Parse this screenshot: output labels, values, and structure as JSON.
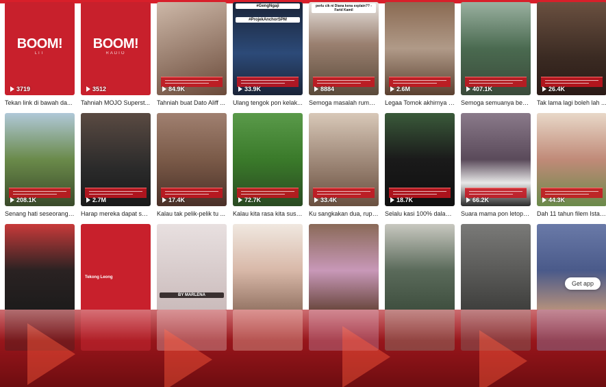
{
  "cards": [
    {
      "views": "3719",
      "caption": "Tekan link di bawah da...",
      "bg": "#c8202c",
      "logo": "BOOM!",
      "logo_sub": "LIT"
    },
    {
      "views": "3512",
      "caption": "Tahniah MOJO Superst...",
      "bg": "#c8202c",
      "logo": "BOOM!",
      "logo_sub": "RADIO"
    },
    {
      "views": "84.9K",
      "caption": "Tahniah buat Dato Aliff ...",
      "bg": "#9a6a58"
    },
    {
      "views": "33.9K",
      "caption": "Ulang tengok pon kelak...",
      "bg": "#2c3d58",
      "top_text": "#GengNgaji",
      "top_text2": "#ProjekAnchorSPM"
    },
    {
      "views": "8884",
      "caption": "Semoga masalah rumah...",
      "bg": "#8c7a6a",
      "top_text": "perlu cik ni Diana kena explain?? - Farid Kamil"
    },
    {
      "views": "2.6M",
      "caption": "Legaa Tomok akhirnya r...",
      "bg": "#6e5a4a"
    },
    {
      "views": "407.1K",
      "caption": "Semoga semuanya berj...",
      "bg": "#5a7a5a"
    },
    {
      "views": "26.4K",
      "caption": "Tak lama lagi boleh lah ...",
      "bg": "#4a3a32"
    },
    {
      "views": "208.1K",
      "caption": "Senang hati seseorang a...",
      "bg": "#6a8a4a"
    },
    {
      "views": "2.7M",
      "caption": "Harap mereka dapat sel...",
      "bg": "#3a3a3a"
    },
    {
      "views": "17.4K",
      "caption": "Kalau tak pelik-pelik tu ...",
      "bg": "#7a5a48"
    },
    {
      "views": "72.7K",
      "caption": "Kalau kita rasa kita susa...",
      "bg": "#4a7a3a"
    },
    {
      "views": "33.4K",
      "caption": "Ku sangkakan dua, rupa...",
      "bg": "#a08a7a"
    },
    {
      "views": "18.7K",
      "caption": "Selalu kasi 100% dalam ...",
      "bg": "#2a2a2a"
    },
    {
      "views": "66.2K",
      "caption": "Suara mama pon letop! ...",
      "bg": "#5a4a5a"
    },
    {
      "views": "44.3K",
      "caption": "Dah 11 tahun filem Istan...",
      "bg": "#8a6a5a"
    },
    {
      "views": "",
      "caption": "",
      "bg": "#3a2a2a"
    },
    {
      "views": "",
      "caption": "",
      "bg": "#c8202c",
      "name_tag": "Tekong Leong"
    },
    {
      "views": "",
      "caption": "",
      "bg": "#d8d0d0",
      "brand": "BY MARLENA"
    },
    {
      "views": "",
      "caption": "",
      "bg": "#c8a898"
    },
    {
      "views": "",
      "caption": "",
      "bg": "#7a5a48"
    },
    {
      "views": "",
      "caption": "",
      "bg": "#5a6a5a"
    },
    {
      "views": "",
      "caption": "",
      "bg": "#6a6a6a"
    },
    {
      "views": "",
      "caption": "",
      "bg": "#4a5a8a"
    }
  ],
  "get_app_label": "Get app",
  "colors": {
    "brand_red": "#c8202c",
    "reflection_red": "#8e1318"
  }
}
